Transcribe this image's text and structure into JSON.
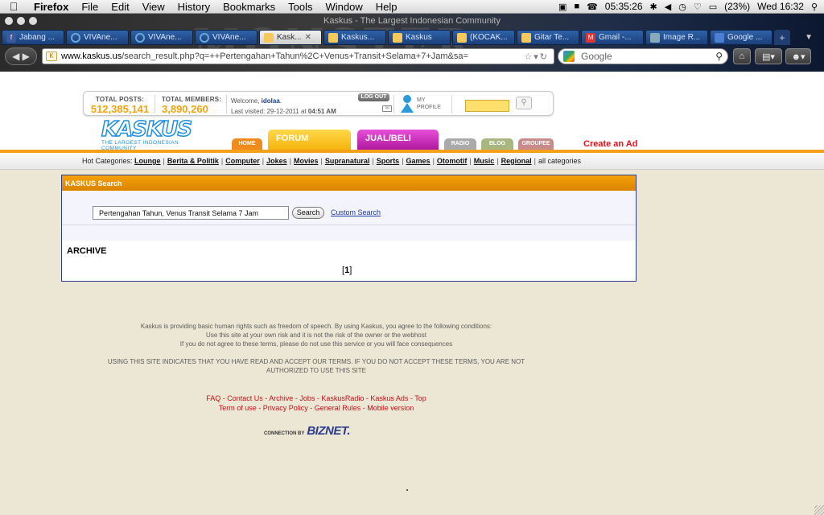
{
  "menubar": {
    "app": "Firefox",
    "items": [
      "File",
      "Edit",
      "View",
      "History",
      "Bookmarks",
      "Tools",
      "Window",
      "Help"
    ],
    "clock_elapsed": "05:35:26",
    "battery": "(23%)",
    "datetime": "Wed 16:32"
  },
  "window": {
    "title": "Kaskus - The Largest Indonesian Community",
    "watermark": "MONSTER"
  },
  "tabs": [
    {
      "label": "Jabang ...",
      "fav": "f"
    },
    {
      "label": "VIVAne...",
      "fav": ""
    },
    {
      "label": "VIVAne...",
      "fav": ""
    },
    {
      "label": "VIVAne...",
      "fav": ""
    },
    {
      "label": "Kask...",
      "fav": "",
      "active": true
    },
    {
      "label": "Kaskus...",
      "fav": ""
    },
    {
      "label": "Kaskus",
      "fav": ""
    },
    {
      "label": "(KOCAK...",
      "fav": ""
    },
    {
      "label": "Gitar Te...",
      "fav": ""
    },
    {
      "label": "Gmail -...",
      "fav": "M"
    },
    {
      "label": "Image R...",
      "fav": ""
    },
    {
      "label": "Google ...",
      "fav": ""
    }
  ],
  "navbar": {
    "url_domain": "www.kaskus.us",
    "url_path": "/search_result.php?q=++Pertengahan+Tahun%2C+Venus+Transit+Selama+7+Jam&sa=",
    "search_placeholder": "Google"
  },
  "stats": {
    "total_posts_label": "TOTAL POSTS:",
    "total_posts": "512,385,141",
    "total_members_label": "TOTAL MEMBERS:",
    "total_members": "3,890,260",
    "welcome": "Welcome,",
    "username": "idolaa",
    "last_visited_prefix": "Last visited: 29-12-2011 at",
    "last_visited_time": "04:51 AM",
    "logout": "LOG OUT",
    "profile_line1": "MY",
    "profile_line2": "PROFILE"
  },
  "logo": {
    "word": "KASKUS",
    "sub": "THE LARGEST INDONESIAN COMMUNITY"
  },
  "navtabs": {
    "home": "HOME",
    "forum": "FORUM",
    "jual": "JUAL/BELI",
    "radio": "RADIO",
    "blog": "BLOG",
    "groupee": "GROUPEE",
    "create_ad": "Create an Ad"
  },
  "categories": {
    "prefix": "Hot Categories:",
    "items": [
      "Lounge",
      "Berita & Politik",
      "Computer",
      "Jokes",
      "Movies",
      "Supranatural",
      "Sports",
      "Games",
      "Otomotif",
      "Music",
      "Regional"
    ],
    "all": "all categories"
  },
  "search": {
    "panel_title": "KASKUS Search",
    "query": "Pertengahan Tahun, Venus Transit Selama 7 Jam",
    "button": "Search",
    "custom": "Custom Search",
    "section": "ARCHIVE",
    "page_open": "[",
    "page": "1",
    "page_close": "]"
  },
  "footer": {
    "notice": [
      "Kaskus is providing basic human rights such as freedom of speech. By using Kaskus, you agree to the following conditions:",
      "Use this site at your own risk and it is not the risk of the owner or the webhost",
      "If you do not agree to these terms, please do not use this service or you will face consequences"
    ],
    "terms": [
      "USING THIS SITE INDICATES THAT YOU HAVE READ AND ACCEPT OUR TERMS. IF YOU DO NOT ACCEPT THESE TERMS, YOU ARE NOT",
      "AUTHORIZED TO USE THIS SITE"
    ],
    "links_row1": [
      "FAQ",
      "Contact Us",
      "Archive",
      "Jobs",
      "KaskusRadio",
      "Kaskus Ads",
      "Top"
    ],
    "links_row2": [
      "Term of use",
      "Privacy Policy",
      "General Rules",
      "Mobile version"
    ],
    "connection": "CONNECTION BY",
    "biznet": "BIZNET."
  },
  "colors": {
    "accent": "#f4a01a",
    "link_red": "#c8101a",
    "logo_blue": "#1e8fe0"
  }
}
